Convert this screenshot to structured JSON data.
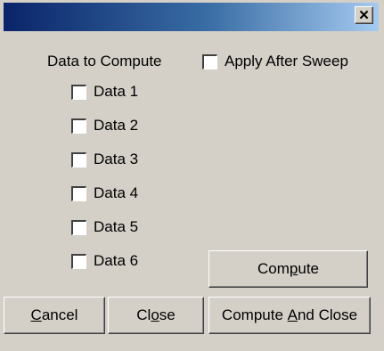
{
  "window": {
    "close_glyph": "✕"
  },
  "group": {
    "label": "Data to Compute",
    "items": [
      {
        "label": "Data 1",
        "checked": false
      },
      {
        "label": "Data 2",
        "checked": false
      },
      {
        "label": "Data 3",
        "checked": false
      },
      {
        "label": "Data 4",
        "checked": false
      },
      {
        "label": "Data 5",
        "checked": false
      },
      {
        "label": "Data 6",
        "checked": false
      }
    ]
  },
  "apply_after_sweep": {
    "label": "Apply After Sweep",
    "checked": false
  },
  "buttons": {
    "compute": {
      "pre": "Com",
      "mnemonic": "p",
      "post": "ute"
    },
    "cancel": {
      "pre": "",
      "mnemonic": "C",
      "post": "ancel"
    },
    "close": {
      "pre": "Cl",
      "mnemonic": "o",
      "post": "se"
    },
    "compute_and_close": {
      "pre": "Compute ",
      "mnemonic": "A",
      "post": "nd Close"
    }
  }
}
